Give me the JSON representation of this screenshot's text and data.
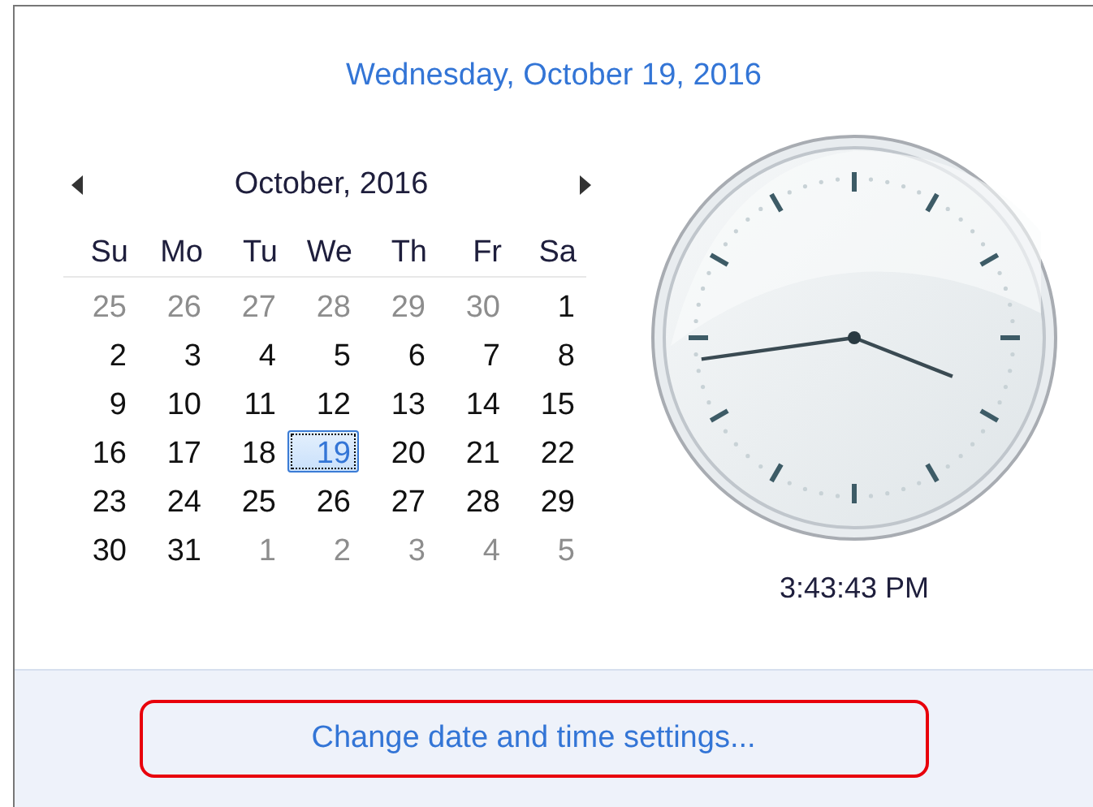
{
  "date_header": "Wednesday, October 19, 2016",
  "calendar": {
    "month_title": "October, 2016",
    "day_names": [
      "Su",
      "Mo",
      "Tu",
      "We",
      "Th",
      "Fr",
      "Sa"
    ],
    "weeks": [
      [
        {
          "day": "25",
          "outside": true,
          "selected": false
        },
        {
          "day": "26",
          "outside": true,
          "selected": false
        },
        {
          "day": "27",
          "outside": true,
          "selected": false
        },
        {
          "day": "28",
          "outside": true,
          "selected": false
        },
        {
          "day": "29",
          "outside": true,
          "selected": false
        },
        {
          "day": "30",
          "outside": true,
          "selected": false
        },
        {
          "day": "1",
          "outside": false,
          "selected": false
        }
      ],
      [
        {
          "day": "2",
          "outside": false,
          "selected": false
        },
        {
          "day": "3",
          "outside": false,
          "selected": false
        },
        {
          "day": "4",
          "outside": false,
          "selected": false
        },
        {
          "day": "5",
          "outside": false,
          "selected": false
        },
        {
          "day": "6",
          "outside": false,
          "selected": false
        },
        {
          "day": "7",
          "outside": false,
          "selected": false
        },
        {
          "day": "8",
          "outside": false,
          "selected": false
        }
      ],
      [
        {
          "day": "9",
          "outside": false,
          "selected": false
        },
        {
          "day": "10",
          "outside": false,
          "selected": false
        },
        {
          "day": "11",
          "outside": false,
          "selected": false
        },
        {
          "day": "12",
          "outside": false,
          "selected": false
        },
        {
          "day": "13",
          "outside": false,
          "selected": false
        },
        {
          "day": "14",
          "outside": false,
          "selected": false
        },
        {
          "day": "15",
          "outside": false,
          "selected": false
        }
      ],
      [
        {
          "day": "16",
          "outside": false,
          "selected": false
        },
        {
          "day": "17",
          "outside": false,
          "selected": false
        },
        {
          "day": "18",
          "outside": false,
          "selected": false
        },
        {
          "day": "19",
          "outside": false,
          "selected": true
        },
        {
          "day": "20",
          "outside": false,
          "selected": false
        },
        {
          "day": "21",
          "outside": false,
          "selected": false
        },
        {
          "day": "22",
          "outside": false,
          "selected": false
        }
      ],
      [
        {
          "day": "23",
          "outside": false,
          "selected": false
        },
        {
          "day": "24",
          "outside": false,
          "selected": false
        },
        {
          "day": "25",
          "outside": false,
          "selected": false
        },
        {
          "day": "26",
          "outside": false,
          "selected": false
        },
        {
          "day": "27",
          "outside": false,
          "selected": false
        },
        {
          "day": "28",
          "outside": false,
          "selected": false
        },
        {
          "day": "29",
          "outside": false,
          "selected": false
        }
      ],
      [
        {
          "day": "30",
          "outside": false,
          "selected": false
        },
        {
          "day": "31",
          "outside": false,
          "selected": false
        },
        {
          "day": "1",
          "outside": true,
          "selected": false
        },
        {
          "day": "2",
          "outside": true,
          "selected": false
        },
        {
          "day": "3",
          "outside": true,
          "selected": false
        },
        {
          "day": "4",
          "outside": true,
          "selected": false
        },
        {
          "day": "5",
          "outside": true,
          "selected": false
        }
      ]
    ]
  },
  "clock_time": "3:43:43 PM",
  "settings_link": {
    "label": "Change date and time settings...",
    "highlighted": true
  }
}
